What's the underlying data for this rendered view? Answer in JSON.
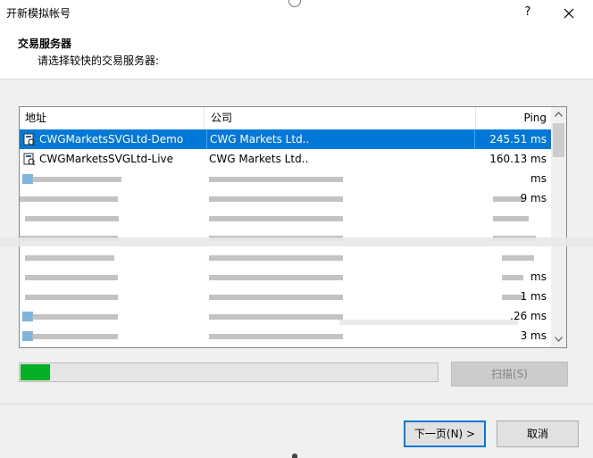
{
  "window": {
    "title": "开新模拟帐号",
    "help_label": "?",
    "close_label": "✕"
  },
  "header": {
    "title": "交易服务器",
    "subtitle": "请选择较快的交易服务器:"
  },
  "server_list": {
    "columns": [
      "地址",
      "公司",
      "Ping"
    ],
    "rows": [
      {
        "address": "CWGMarketsSVGLtd-Demo",
        "company": "CWG Markets Ltd..",
        "ping": "245.51 ms",
        "selected": true
      },
      {
        "address": "CWGMarketsSVGLtd-Live",
        "company": "CWG Markets Ltd..",
        "ping": "160.13 ms",
        "selected": false
      }
    ],
    "blurred_ping_fragments": [
      "ms",
      "9 ms",
      "",
      "",
      "",
      "ms",
      "1 ms",
      ".26 ms",
      "3 ms"
    ],
    "selection_color": "#0078d7"
  },
  "progress": {
    "fraction": 0.07,
    "color": "#06b025"
  },
  "buttons": {
    "scan": "扫描(S)",
    "next": "下一页(N) >",
    "cancel": "取消"
  },
  "icons": {
    "server": "server-icon",
    "scroll_up": "chevron-up-icon",
    "scroll_down": "chevron-down-icon",
    "close": "close-icon"
  }
}
